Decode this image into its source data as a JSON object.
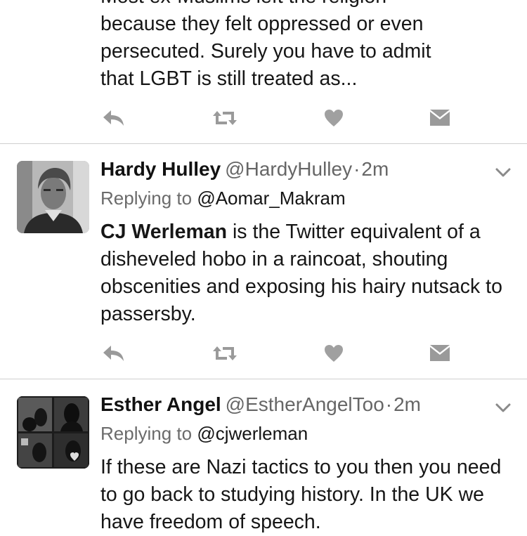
{
  "tweet0": {
    "text_lines": [
      "Most ex-Muslims left the religion",
      "because they felt oppressed or even",
      "persecuted. Surely you have to admit",
      "that LGBT is still treated as..."
    ]
  },
  "tweet1": {
    "name": "Hardy Hulley",
    "handle": "@HardyHulley",
    "time": "2m",
    "replying_prefix": "Replying to",
    "replying_to": "@Aomar_Makram",
    "mention": "CJ Werleman",
    "text_rest": " is the Twitter equivalent of a disheveled hobo in a raincoat, shouting obscenities and exposing his hairy nutsack to passersby."
  },
  "tweet2": {
    "name": "Esther Angel",
    "handle": "@EstherAngelToo",
    "time": "2m",
    "replying_prefix": "Replying to",
    "replying_to": "@cjwerleman",
    "text": "If these are Nazi tactics to you then you need to go back to studying history. In the UK we have freedom of speech."
  },
  "separator": "·",
  "icons": {
    "reply": "reply-icon",
    "retweet": "retweet-icon",
    "like": "heart-icon",
    "dm": "envelope-icon",
    "more": "chevron-down-icon"
  }
}
